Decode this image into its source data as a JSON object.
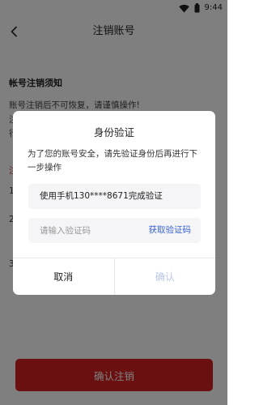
{
  "status_bar": {
    "time": "9:44",
    "icons": [
      "wifi-icon",
      "battery-icon"
    ]
  },
  "header": {
    "back_icon": "back-arrow-icon",
    "title": "注销账号"
  },
  "page": {
    "notice_title": "帐号注销须知",
    "notice_line1": "账号注销后不可恢复，请谨慎操作!",
    "notice_frag_a": "注",
    "notice_frag_b": "行",
    "notice_frag_c": "注",
    "notice_frag_d": "1",
    "notice_frag_e": "2",
    "notice_frag_f": "3",
    "confirm_button_label": "确认注销"
  },
  "dialog": {
    "title": "身份验证",
    "message": "为了您的账号安全，请先验证身份后再进行下一步操作",
    "phone_text": "使用手机130****8671完成验证",
    "code_placeholder": "请输入验证码",
    "get_code_label": "获取验证码",
    "cancel_label": "取消",
    "ok_label": "确认"
  },
  "colors": {
    "accent_red": "#d42020",
    "link_blue": "#3a62d6",
    "disabled_blue": "#b9c6ea",
    "overlay": "rgba(0,0,0,0.5)"
  }
}
